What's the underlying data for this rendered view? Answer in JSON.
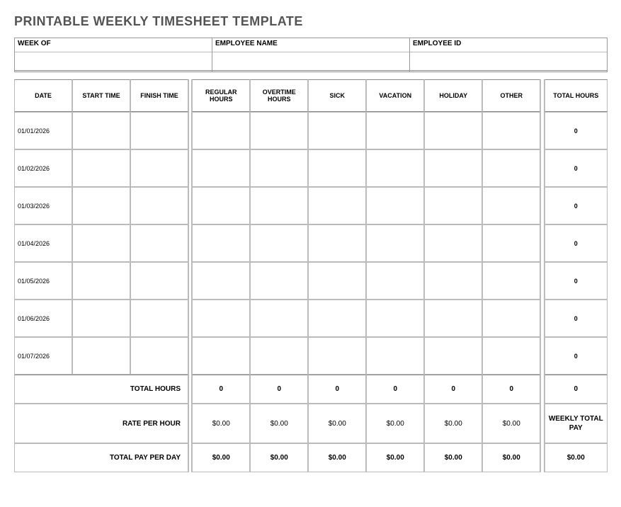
{
  "title": "PRINTABLE WEEKLY TIMESHEET TEMPLATE",
  "info": {
    "weekOf": {
      "label": "WEEK OF",
      "value": ""
    },
    "employeeName": {
      "label": "EMPLOYEE NAME",
      "value": ""
    },
    "employeeId": {
      "label": "EMPLOYEE ID",
      "value": ""
    }
  },
  "headers": {
    "date": "DATE",
    "startTime": "START TIME",
    "finishTime": "FINISH TIME",
    "regular": "REGULAR HOURS",
    "overtime": "OVERTIME HOURS",
    "sick": "SICK",
    "vacation": "VACATION",
    "holiday": "HOLIDAY",
    "other": "OTHER",
    "totalHours": "TOTAL HOURS"
  },
  "rows": [
    {
      "date": "01/01/2026",
      "start": "",
      "finish": "",
      "regular": "",
      "overtime": "",
      "sick": "",
      "vacation": "",
      "holiday": "",
      "other": "",
      "total": "0"
    },
    {
      "date": "01/02/2026",
      "start": "",
      "finish": "",
      "regular": "",
      "overtime": "",
      "sick": "",
      "vacation": "",
      "holiday": "",
      "other": "",
      "total": "0"
    },
    {
      "date": "01/03/2026",
      "start": "",
      "finish": "",
      "regular": "",
      "overtime": "",
      "sick": "",
      "vacation": "",
      "holiday": "",
      "other": "",
      "total": "0"
    },
    {
      "date": "01/04/2026",
      "start": "",
      "finish": "",
      "regular": "",
      "overtime": "",
      "sick": "",
      "vacation": "",
      "holiday": "",
      "other": "",
      "total": "0"
    },
    {
      "date": "01/05/2026",
      "start": "",
      "finish": "",
      "regular": "",
      "overtime": "",
      "sick": "",
      "vacation": "",
      "holiday": "",
      "other": "",
      "total": "0"
    },
    {
      "date": "01/06/2026",
      "start": "",
      "finish": "",
      "regular": "",
      "overtime": "",
      "sick": "",
      "vacation": "",
      "holiday": "",
      "other": "",
      "total": "0"
    },
    {
      "date": "01/07/2026",
      "start": "",
      "finish": "",
      "regular": "",
      "overtime": "",
      "sick": "",
      "vacation": "",
      "holiday": "",
      "other": "",
      "total": "0"
    }
  ],
  "summary": {
    "totalHoursLabel": "TOTAL HOURS",
    "totals": {
      "regular": "0",
      "overtime": "0",
      "sick": "0",
      "vacation": "0",
      "holiday": "0",
      "other": "0",
      "grand": "0"
    },
    "rateLabel": "RATE PER HOUR",
    "rates": {
      "regular": "$0.00",
      "overtime": "$0.00",
      "sick": "$0.00",
      "vacation": "$0.00",
      "holiday": "$0.00",
      "other": "$0.00"
    },
    "weeklyTotalPayLabel": "WEEKLY TOTAL PAY",
    "totalPayLabel": "TOTAL PAY PER DAY",
    "pays": {
      "regular": "$0.00",
      "overtime": "$0.00",
      "sick": "$0.00",
      "vacation": "$0.00",
      "holiday": "$0.00",
      "other": "$0.00",
      "weekly": "$0.00"
    }
  }
}
